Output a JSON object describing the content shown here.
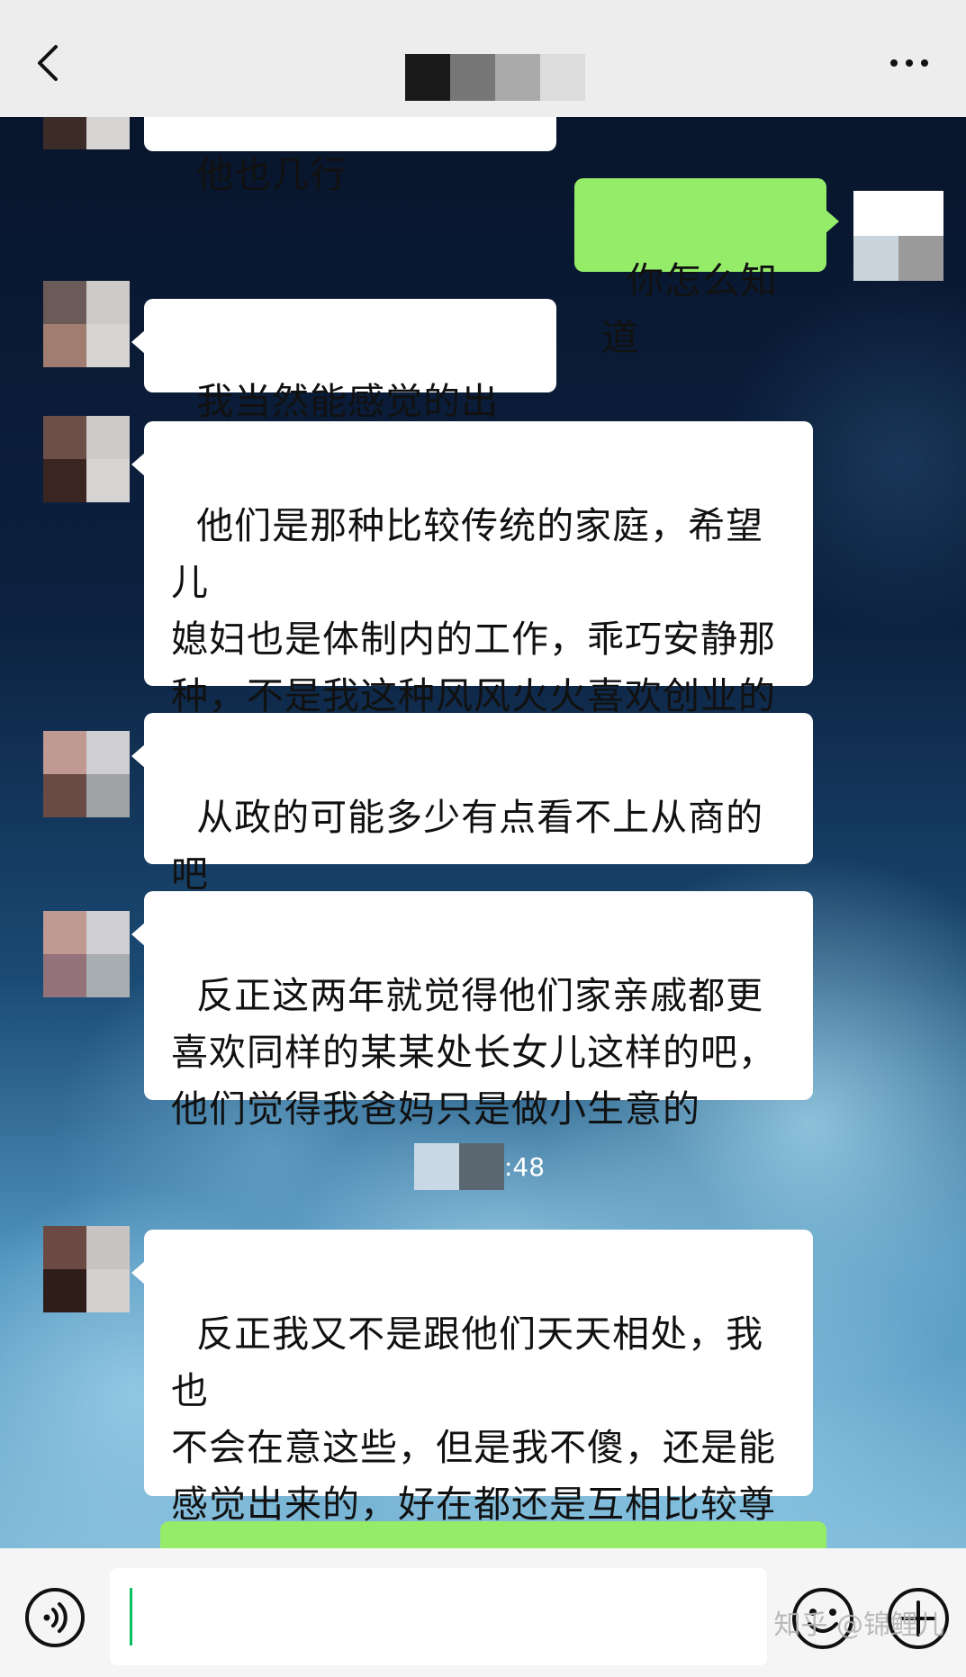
{
  "header": {
    "back_icon": "chevron-left-icon",
    "more_icon": "more-dots-icon",
    "title_blur_colors": [
      "#1a1a1a",
      "#777777",
      "#aaaaaa",
      "#dddddd"
    ]
  },
  "messages": [
    {
      "side": "left",
      "text": "他也几行",
      "partial": true
    },
    {
      "side": "right",
      "text": "你怎么知道"
    },
    {
      "side": "left",
      "text": "我当然能感觉的出来"
    },
    {
      "side": "left",
      "text": "他们是那种比较传统的家庭，希望儿\n媳妇也是体制内的工作，乖巧安静那\n种，不是我这种风风火火喜欢创业的\n性格"
    },
    {
      "side": "left",
      "text": "从政的可能多少有点看不上从商的\n吧"
    },
    {
      "side": "left",
      "text": "反正这两年就觉得他们家亲戚都更\n喜欢同样的某某处长女儿这样的吧，\n他们觉得我爸妈只是做小生意的"
    },
    {
      "side": "left",
      "text": "反正我又不是跟他们天天相处，我也\n不会在意这些，但是我不傻，还是能\n感觉出来的，好在都还是互相比较尊\n重吧"
    }
  ],
  "timestamp": {
    "visible_text": ":48"
  },
  "input_bar": {
    "voice_icon": "voice-icon",
    "emoji_icon": "emoji-icon",
    "plus_icon": "plus-icon",
    "value": ""
  },
  "watermark": "知乎 @锦鲤儿",
  "colors": {
    "header_bg": "#ededed",
    "bubble_white": "#ffffff",
    "bubble_green": "#95ec69",
    "caret": "#07c160"
  }
}
